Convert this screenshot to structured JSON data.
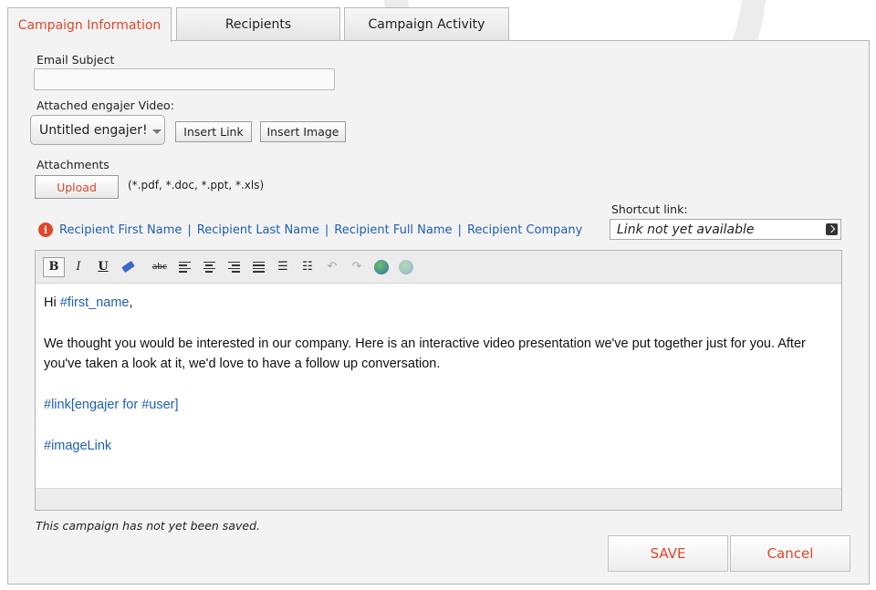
{
  "tabs": [
    {
      "label": "Campaign Information",
      "active": true
    },
    {
      "label": "Recipients",
      "active": false
    },
    {
      "label": "Campaign Activity",
      "active": false
    }
  ],
  "form": {
    "email_subject_label": "Email Subject",
    "email_subject_value": "",
    "video_label": "Attached engajer Video:",
    "video_selected": "Untitled engajer!",
    "insert_link_label": "Insert Link",
    "insert_image_label": "Insert Image",
    "attachments_label": "Attachments",
    "upload_label": "Upload",
    "attachments_hint": "(*.pdf, *.doc, *.ppt, *.xls)",
    "shortcut_label": "Shortcut link:",
    "shortcut_value": "Link not yet available"
  },
  "tokens": [
    "Recipient First Name",
    "Recipient Last Name",
    "Recipient Full Name",
    "Recipient Company"
  ],
  "token_separator": "|",
  "toolbar": {
    "bold": "B",
    "italic": "I",
    "underline": "U",
    "strike": "abc"
  },
  "editor": {
    "greeting": "Hi ",
    "first_name_var": "#first_name",
    "greeting_end": ",",
    "body": "We thought you would be interested in our company. Here is an interactive video presentation we've put together just for you. After you've taken a look at it, we'd love to have a follow up conversation.",
    "link_var": "#link[engajer for #user]",
    "image_var": "#imageLink"
  },
  "status_text": "This campaign has not yet been saved.",
  "actions": {
    "save_label": "SAVE",
    "cancel_label": "Cancel"
  },
  "colors": {
    "accent": "#e0462a",
    "link": "#1f5fb4"
  }
}
